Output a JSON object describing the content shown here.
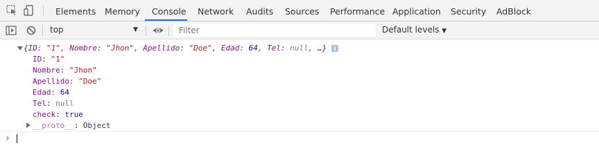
{
  "tabs": [
    {
      "label": "Elements"
    },
    {
      "label": "Memory"
    },
    {
      "label": "Console",
      "active": true
    },
    {
      "label": "Network"
    },
    {
      "label": "Audits"
    },
    {
      "label": "Sources"
    },
    {
      "label": "Performance"
    },
    {
      "label": "Application"
    },
    {
      "label": "Security"
    },
    {
      "label": "AdBlock"
    }
  ],
  "toolbar": {
    "context": "top",
    "filter_placeholder": "Filter",
    "levels": "Default levels"
  },
  "console": {
    "summary": {
      "open": "{",
      "id_key": "ID: ",
      "id_val": "\"1\"",
      "nombre_key": "Nombre: ",
      "nombre_val": "\"Jhon\"",
      "apellido_key": "Apellido: ",
      "apellido_val": "\"Doe\"",
      "edad_key": "Edad: ",
      "edad_val": "64",
      "tel_key": "Tel: ",
      "tel_val": "null",
      "close": ", …}",
      "sep": ", "
    },
    "info_badge": "i",
    "props": [
      {
        "key": "ID",
        "value": "\"1\"",
        "type": "str"
      },
      {
        "key": "Nombre",
        "value": "\"Jhon\"",
        "type": "str"
      },
      {
        "key": "Apellido",
        "value": "\"Doe\"",
        "type": "str"
      },
      {
        "key": "Edad",
        "value": "64",
        "type": "num"
      },
      {
        "key": "Tel",
        "value": "null",
        "type": "null"
      },
      {
        "key": "check",
        "value": "true",
        "type": "bool"
      }
    ],
    "proto_key": "__proto__",
    "proto_value": "Object",
    "prompt_symbol": "›"
  },
  "colors": {
    "accent": "#1a73e8",
    "key": "#881391",
    "string": "#c41a16",
    "number": "#1c00cf"
  },
  "icons": [
    "inspect-element-icon",
    "device-toolbar-icon",
    "sidebar-toggle-icon",
    "clear-console-icon",
    "eye-icon",
    "dropdown-arrow-icon",
    "expand-triangle-icon",
    "info-icon",
    "prompt-chevron-icon"
  ]
}
